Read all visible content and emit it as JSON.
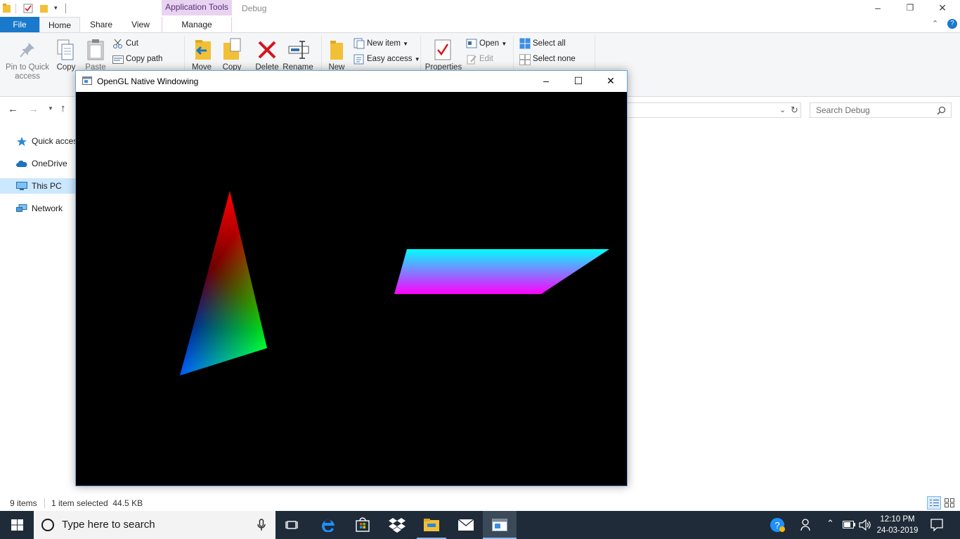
{
  "explorer": {
    "context_tab": "Application Tools",
    "window_title": "Debug",
    "tabs": {
      "file": "File",
      "home": "Home",
      "share": "Share",
      "view": "View",
      "manage": "Manage"
    },
    "ribbon": {
      "pin": "Pin to Quick\naccess",
      "copy": "Copy",
      "paste": "Paste",
      "cut": "Cut",
      "copy_path": "Copy path",
      "move": "Move",
      "copy_to": "Copy",
      "delete": "Delete",
      "rename": "Rename",
      "new": "New",
      "new_item": "New item",
      "easy_access": "Easy access",
      "properties": "Properties",
      "open": "Open",
      "edit": "Edit",
      "select_all": "Select all",
      "select_none": "Select none"
    },
    "search_placeholder": "Search Debug",
    "nav": [
      "Quick access",
      "OneDrive",
      "This PC",
      "Network"
    ],
    "status": {
      "items": "9 items",
      "selected": "1 item selected  44.5 KB"
    }
  },
  "gl_window": {
    "title": "OpenGL Native Windowing"
  },
  "taskbar": {
    "search_placeholder": "Type here to search",
    "time": "12:10 PM",
    "date": "24-03-2019"
  },
  "colors": {
    "accent": "#1979ca",
    "context_tab": "#e8d3f0",
    "taskbar": "#1f2b38",
    "delete_red": "#d4161c"
  }
}
